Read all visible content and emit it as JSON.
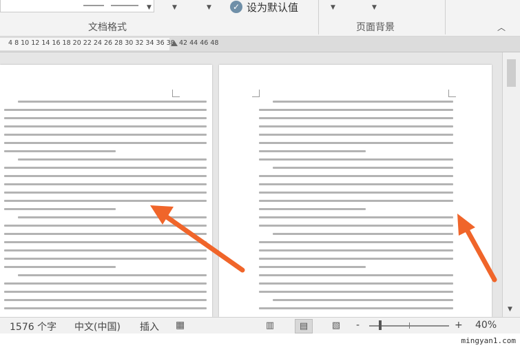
{
  "ribbon": {
    "set_default_label": "设为默认值",
    "group_document_format": "文档格式",
    "group_page_background": "页面背景",
    "collapse_icon": "chevron-up-icon"
  },
  "ruler": {
    "numbers_left": "4  8 10 12 14 16 18 20 22 24 26 28 30 32 34 36 38",
    "numbers_right": "42 44 46 48"
  },
  "status": {
    "word_count": "1576 个字",
    "language": "中文(中国)",
    "insert_mode": "插入",
    "zoom_minus": "-",
    "zoom_plus": "+",
    "zoom_level": "40%",
    "zoom_percent": 40
  },
  "colors": {
    "arrow": "#f0652a",
    "check": "#6f8fa8"
  },
  "watermark": "mingyan1.com"
}
